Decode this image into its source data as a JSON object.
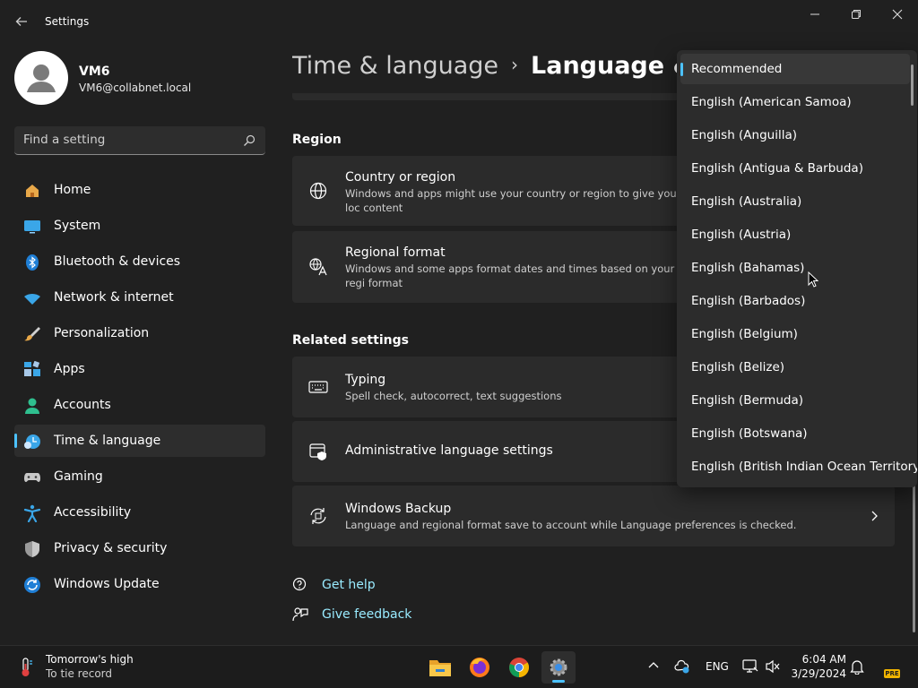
{
  "window": {
    "title": "Settings"
  },
  "profile": {
    "name": "VM6",
    "email": "VM6@collabnet.local"
  },
  "search": {
    "placeholder": "Find a setting"
  },
  "nav": {
    "items": [
      {
        "label": "Home",
        "icon": "home-icon"
      },
      {
        "label": "System",
        "icon": "system-icon"
      },
      {
        "label": "Bluetooth & devices",
        "icon": "bluetooth-icon"
      },
      {
        "label": "Network & internet",
        "icon": "wifi-icon"
      },
      {
        "label": "Personalization",
        "icon": "brush-icon"
      },
      {
        "label": "Apps",
        "icon": "apps-icon"
      },
      {
        "label": "Accounts",
        "icon": "accounts-icon"
      },
      {
        "label": "Time & language",
        "icon": "time-language-icon",
        "active": true
      },
      {
        "label": "Gaming",
        "icon": "gamepad-icon"
      },
      {
        "label": "Accessibility",
        "icon": "accessibility-icon"
      },
      {
        "label": "Privacy & security",
        "icon": "shield-icon"
      },
      {
        "label": "Windows Update",
        "icon": "update-icon"
      }
    ]
  },
  "breadcrumb": {
    "parent": "Time & language",
    "separator": "›",
    "current": "Language & re"
  },
  "region": {
    "heading": "Region",
    "country": {
      "title": "Country or region",
      "desc": "Windows and apps might use your country or region to give you loc content",
      "icon": "globe-icon"
    },
    "format": {
      "title": "Regional format",
      "desc": "Windows and some apps format dates and times based on your regi format",
      "icon": "regional-format-icon"
    }
  },
  "related": {
    "heading": "Related settings",
    "typing": {
      "title": "Typing",
      "desc": "Spell check, autocorrect, text suggestions",
      "icon": "keyboard-icon"
    },
    "admin": {
      "title": "Administrative language settings",
      "icon": "admin-settings-icon"
    },
    "backup": {
      "title": "Windows Backup",
      "desc": "Language and regional format save to account while Language preferences is checked.",
      "icon": "backup-icon"
    }
  },
  "links": {
    "help": "Get help",
    "feedback": "Give feedback"
  },
  "dropdown": {
    "selected_index": 0,
    "options": [
      "Recommended",
      "English (American Samoa)",
      "English (Anguilla)",
      "English (Antigua & Barbuda)",
      "English (Australia)",
      "English (Austria)",
      "English (Bahamas)",
      "English (Barbados)",
      "English (Belgium)",
      "English (Belize)",
      "English (Bermuda)",
      "English (Botswana)",
      "English (British Indian Ocean Territory)"
    ]
  },
  "taskbar": {
    "weather_title": "Tomorrow's high",
    "weather_sub": "To tie record",
    "language": "ENG",
    "time": "6:04 AM",
    "date": "3/29/2024",
    "pre_badge": "PRE"
  },
  "colors": {
    "background": "#202020",
    "card": "#2b2b2b",
    "accent": "#4cc2ff",
    "link": "#99ebff"
  }
}
